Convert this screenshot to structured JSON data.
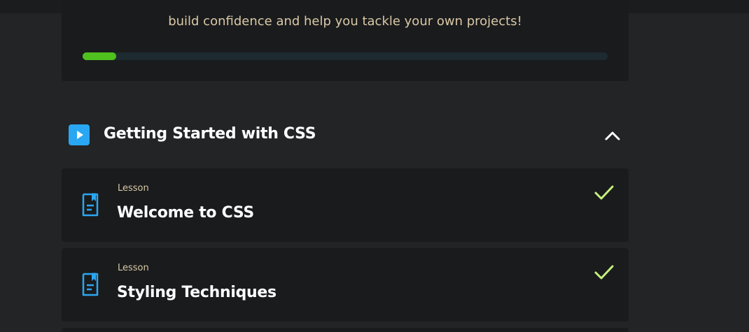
{
  "intro": {
    "text": "build confidence and help you tackle your own projects!",
    "progress_fraction": 0.064,
    "progress_color": "#4fc01d"
  },
  "section": {
    "icon": "play-icon",
    "title": "Getting Started with CSS",
    "toggle_icon": "chevron-up-icon",
    "expanded": true
  },
  "lessons": [
    {
      "kind": "Lesson",
      "title": "Welcome to CSS",
      "icon": "document-icon",
      "status_icon": "check-icon",
      "completed": true
    },
    {
      "kind": "Lesson",
      "title": "Styling Techniques",
      "icon": "document-icon",
      "status_icon": "check-icon",
      "completed": true
    }
  ],
  "colors": {
    "accent_blue": "#2aa7f2",
    "check_green": "#c5f07e",
    "background": "#222426",
    "card": "#1a1b1d"
  }
}
